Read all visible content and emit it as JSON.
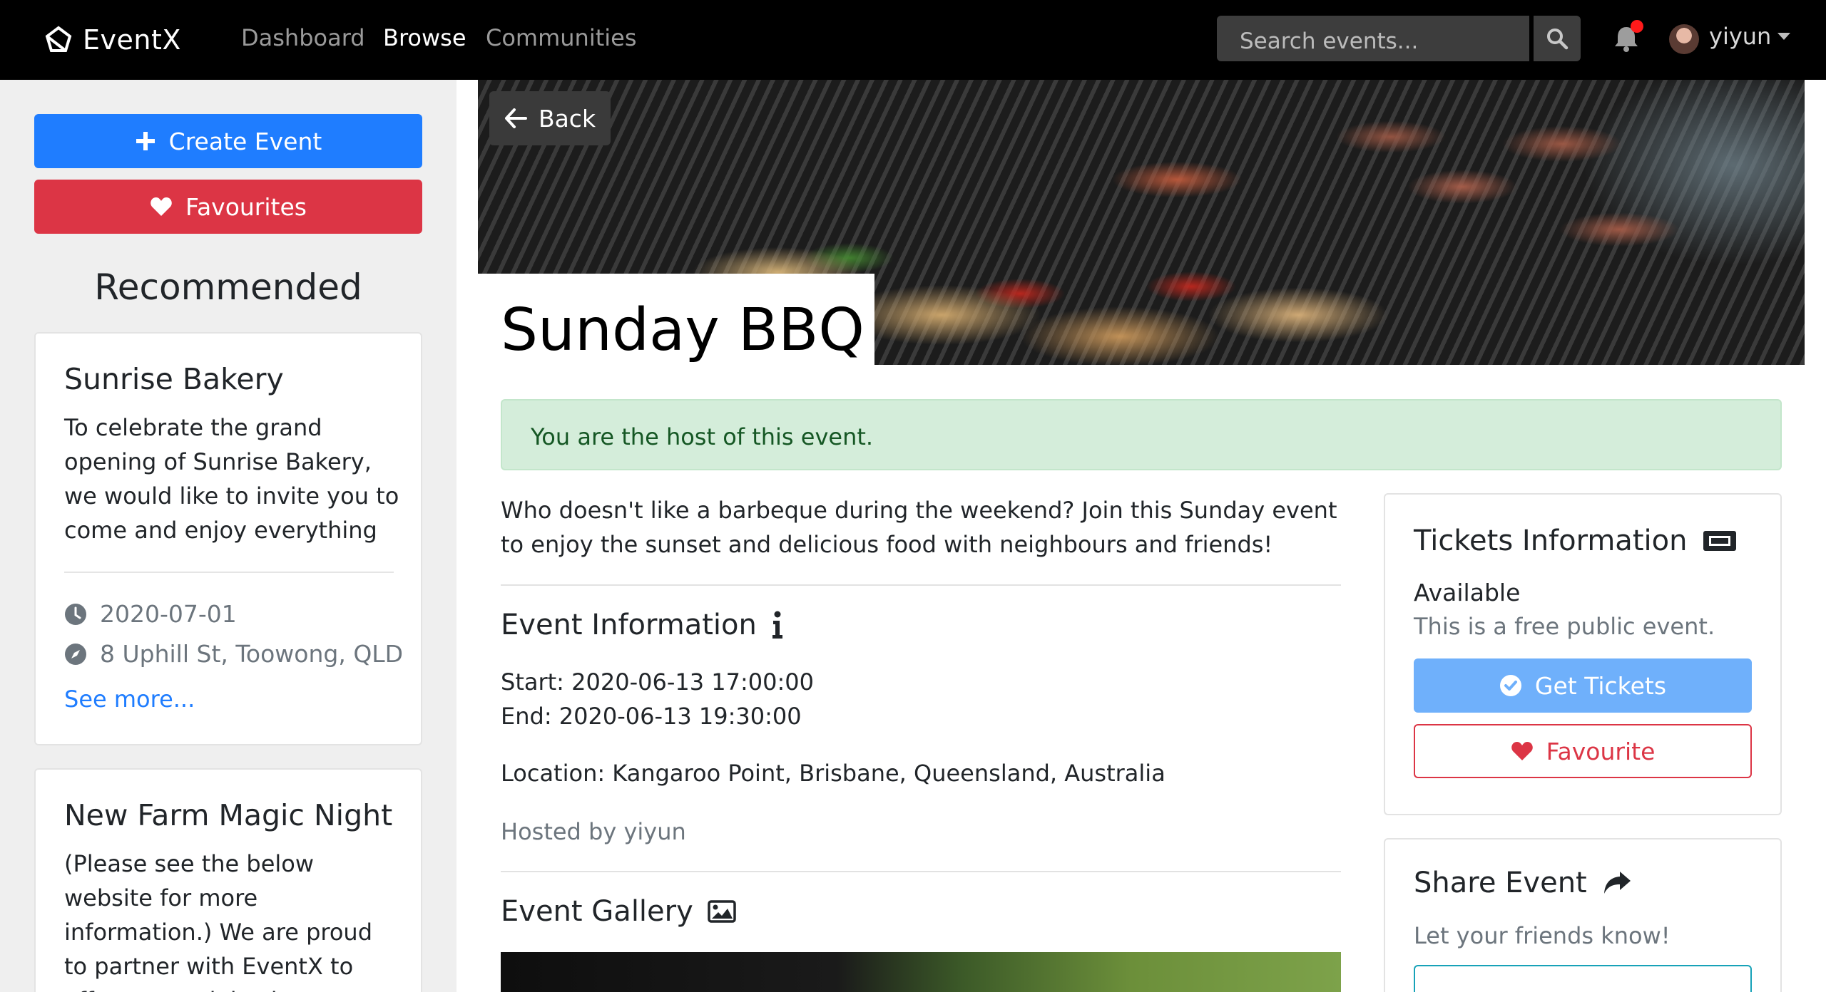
{
  "navbar": {
    "brand": "EventX",
    "links": [
      "Dashboard",
      "Browse",
      "Communities"
    ],
    "active_link": "Browse",
    "search_placeholder": "Search events...",
    "username": "yiyun"
  },
  "sidebar": {
    "create_label": "Create Event",
    "favourites_label": "Favourites",
    "recommended_title": "Recommended",
    "cards": [
      {
        "title": "Sunrise Bakery",
        "description": "To celebrate the grand opening of Sunrise Bakery, we would like to invite you to come and enjoy everything",
        "date": "2020-07-01",
        "location": "8 Uphill St, Toowong, QLD",
        "link": "See more..."
      },
      {
        "title": "New Farm Magic Night",
        "description": "(Please see the below website for more information.) We are proud to partner with EventX to offer you a night-time"
      }
    ]
  },
  "event": {
    "back_label": "Back",
    "title": "Sunday BBQ",
    "host_alert": "You are the host of this event.",
    "description": "Who doesn't like a barbeque during the weekend? Join this Sunday event to enjoy the sunset and delicious food with neighbours and friends!",
    "info_title": "Event Information",
    "start": "Start: 2020-06-13 17:00:00",
    "end": "End: 2020-06-13 19:30:00",
    "location": "Location: Kangaroo Point, Brisbane, Queensland, Australia",
    "hosted_by": "Hosted by yiyun",
    "gallery_title": "Event Gallery"
  },
  "tickets": {
    "title": "Tickets Information",
    "status": "Available",
    "note": "This is a free public event.",
    "get_tickets_label": "Get Tickets",
    "favourite_label": "Favourite"
  },
  "share": {
    "title": "Share Event",
    "subtitle": "Let your friends know!"
  },
  "colors": {
    "primary": "#1f7dff",
    "danger": "#dc3545",
    "success_bg": "#d4edda",
    "success_text": "#155724",
    "navbar": "#000000"
  }
}
